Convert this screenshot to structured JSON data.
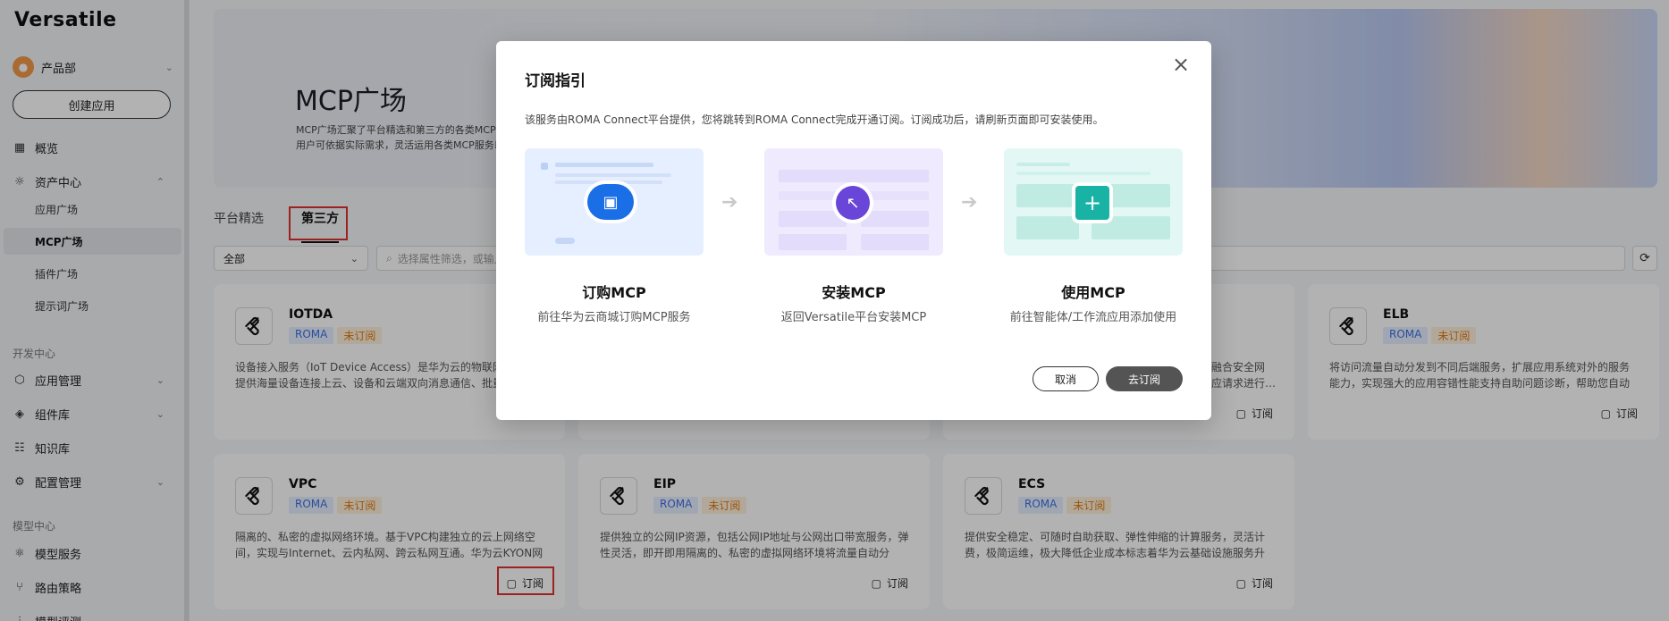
{
  "sidebar": {
    "brand": "Versatile",
    "department": "产品部",
    "create_button": "创建应用",
    "items": {
      "overview": "概览",
      "asset_center": "资产中心",
      "app_plaza": "应用广场",
      "mcp_plaza": "MCP广场",
      "plugin_plaza": "插件广场",
      "prompt_plaza": "提示词广场",
      "dev_center": "开发中心",
      "app_mgmt": "应用管理",
      "component_lib": "组件库",
      "knowledge": "知识库",
      "config_mgmt": "配置管理",
      "model_center": "模型中心",
      "model_service": "模型服务",
      "routing": "路由策略",
      "model_eval": "模型评测"
    }
  },
  "banner": {
    "title": "MCP广场",
    "desc_line1": "MCP广场汇聚了平台精选和第三方的各类MCP服",
    "desc_line2": "用户可依据实际需求，灵活运用各类MCP服务以"
  },
  "tabs": {
    "platform": "平台精选",
    "third_party": "第三方"
  },
  "filter": {
    "selected": "全部",
    "search_placeholder": "选择属性筛选，或输入关键字搜索"
  },
  "cards": [
    {
      "name": "IOTDA",
      "tag_src": "ROMA",
      "tag_status": "未订阅",
      "desc": "设备接入服务（IoT Device Access）是华为云的物联网平台，提供海量设备连接上云、设备和云端双向消息通信、批量设备管理等能力。",
      "subscribe": "订阅"
    },
    {
      "name": "ELB",
      "tag_src": "ROMA",
      "tag_status": "未订阅",
      "desc": "将访问流量自动分发到不同后端服务，扩展应用系统对外的服务能力，实现强大的应用容错性能支持自助问题诊断，帮助您自动化运维。",
      "subscribe": "订阅"
    },
    {
      "name": "VPC",
      "tag_src": "ROMA",
      "tag_status": "未订阅",
      "desc": "隔离的、私密的虚拟网络环境。基于VPC构建独立的云上网络空间，实现与Internet、云内私网、跨云私网互通。华为云KYON网络。",
      "subscribe": "订阅"
    },
    {
      "name": "EIP",
      "tag_src": "ROMA",
      "tag_status": "未订阅",
      "desc": "提供独立的公网IP资源，包括公网IP地址与公网出口带宽服务，弹性灵活，即开即用隔离的、私密的虚拟网络环境将流量自动分发。",
      "subscribe": "订阅"
    },
    {
      "name": "ECS",
      "tag_src": "ROMA",
      "tag_status": "未订阅",
      "desc": "提供安全稳定、可随时自助获取、弹性伸缩的计算服务，灵活计费，极简运维，极大降低企业成本标志着华为云基础设施服务升级。",
      "subscribe": "订阅"
    }
  ],
  "partial_card": {
    "desc_line1": "融合安全网",
    "desc_line2": "应请求进行…",
    "subscribe": "订阅"
  },
  "modal": {
    "title": "订阅指引",
    "desc": "该服务由ROMA Connect平台提供，您将跳转到ROMA Connect完成开通订阅。订阅成功后，请刷新页面即可安装使用。",
    "steps": [
      {
        "title": "订购MCP",
        "desc": "前往华为云商城订购MCP服务"
      },
      {
        "title": "安装MCP",
        "desc": "返回Versatile平台安装MCP"
      },
      {
        "title": "使用MCP",
        "desc": "前往智能体/工作流应用添加使用"
      }
    ],
    "cancel": "取消",
    "confirm": "去订阅"
  },
  "colors": {
    "accent_blue": "#1a6fe6",
    "accent_purple": "#6a46d8",
    "accent_teal": "#19b3a6",
    "highlight_red": "#e03131"
  }
}
